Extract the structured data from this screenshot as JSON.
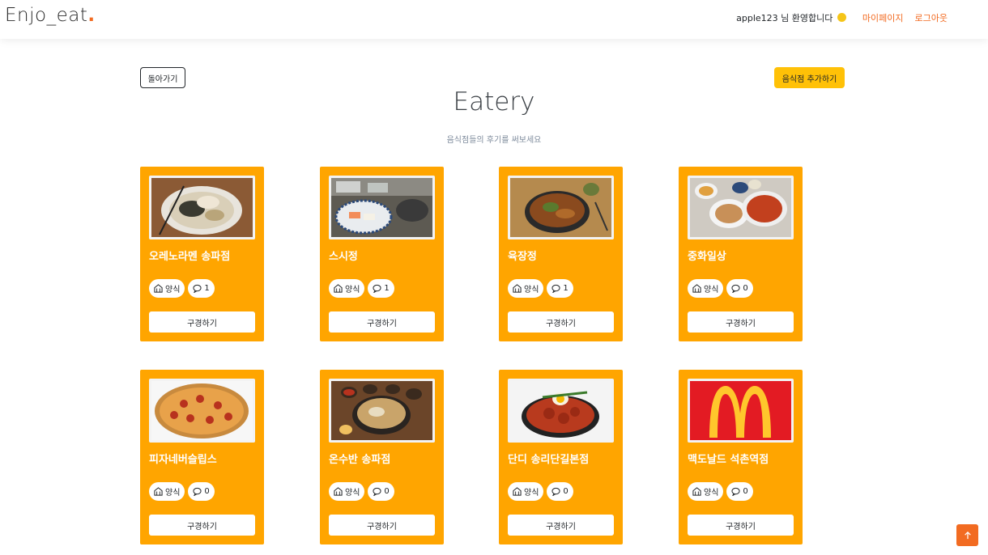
{
  "navbar": {
    "brand_text": "Enjo_eat",
    "brand_dot": ".",
    "welcome": "apple123 님 환영합니다",
    "mypage": "마이페이지",
    "logout": "로그아웃"
  },
  "toolbar": {
    "back_label": "돌아가기",
    "add_label": "음식점 추가하기"
  },
  "header": {
    "title": "Eatery",
    "subtitle": "음식점들의 후기를 써보세요"
  },
  "colors": {
    "accent": "#f26b21",
    "card": "#ffa500",
    "add_button": "#ffc107"
  },
  "cards": [
    {
      "name": "오레노라멘 송파점",
      "category": "양식",
      "comments": "1",
      "visit_label": "구경하기"
    },
    {
      "name": "스시정",
      "category": "양식",
      "comments": "1",
      "visit_label": "구경하기"
    },
    {
      "name": "육장정",
      "category": "양식",
      "comments": "1",
      "visit_label": "구경하기"
    },
    {
      "name": "중화일상",
      "category": "양식",
      "comments": "0",
      "visit_label": "구경하기"
    },
    {
      "name": "피자네버슬립스",
      "category": "양식",
      "comments": "0",
      "visit_label": "구경하기"
    },
    {
      "name": "온수반 송파점",
      "category": "양식",
      "comments": "0",
      "visit_label": "구경하기"
    },
    {
      "name": "단디 송리단길본점",
      "category": "양식",
      "comments": "0",
      "visit_label": "구경하기"
    },
    {
      "name": "맥도날드 석촌역점",
      "category": "양식",
      "comments": "0",
      "visit_label": "구경하기"
    }
  ],
  "icons": {
    "category": "restaurant-icon",
    "comments": "chat-bubble-icon",
    "scroll_top": "arrow-up-icon"
  }
}
